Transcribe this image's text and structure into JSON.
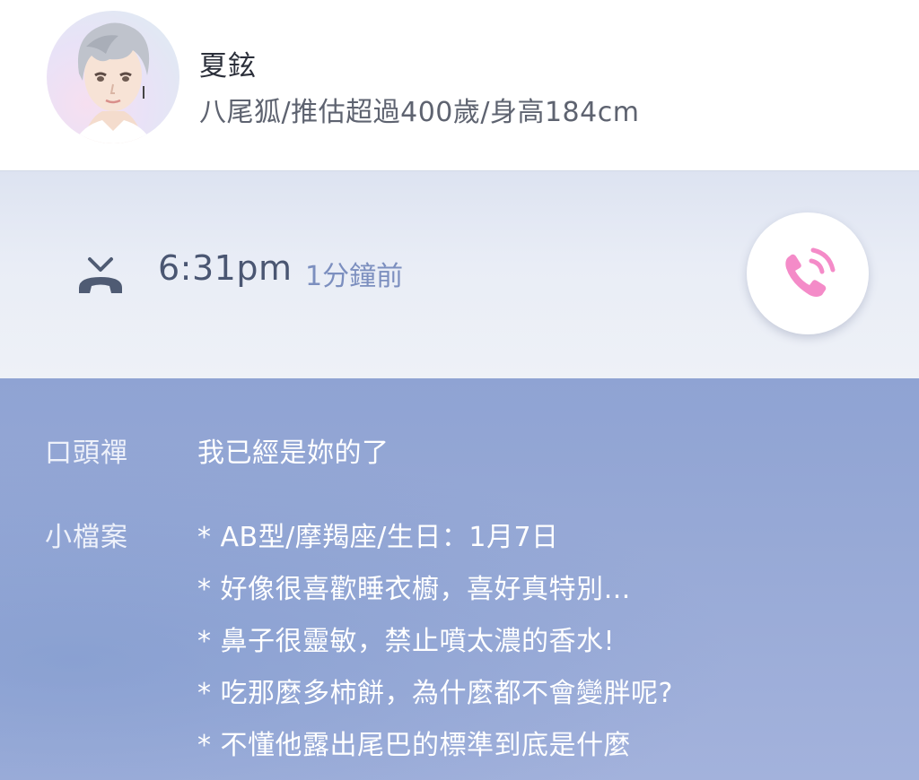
{
  "character": {
    "name": "夏鉉",
    "bio": "八尾狐/推估超過400歲/身高184cm"
  },
  "call": {
    "time": "6:31pm",
    "ago": "1分鐘前",
    "hangup_icon": "phone-hangup-icon",
    "callback_icon": "phone-ringing-icon",
    "accent_color": "#f48bc8"
  },
  "profile": {
    "catchphrase_label": "口頭禪",
    "catchphrase_value": "我已經是妳的了",
    "notes_label": "小檔案",
    "notes": [
      "* AB型/摩羯座/生日：1月7日",
      "* 好像很喜歡睡衣櫥，喜好真特別…",
      "* 鼻子很靈敏，禁止噴太濃的香水!",
      "* 吃那麼多柿餅，為什麼都不會變胖呢?",
      "* 不懂他露出尾巴的標準到底是什麼"
    ]
  }
}
